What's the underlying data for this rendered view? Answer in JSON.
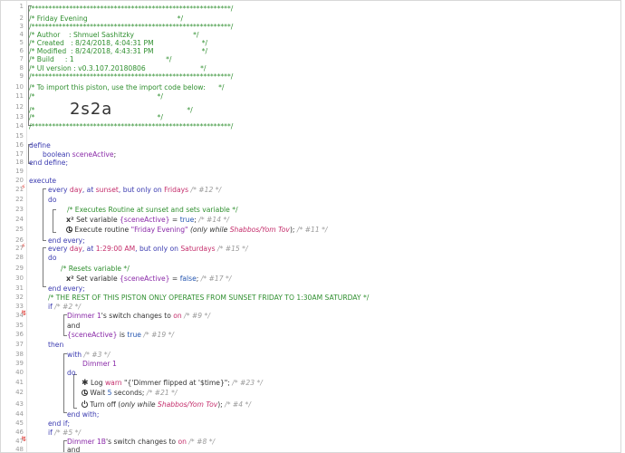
{
  "lines": {
    "l1": "/**********************************************************/",
    "l2": "/* Friday Evening                                         */",
    "l3": "/**********************************************************/",
    "l4": "/* Author    : Shmuel Sashitzky                           */",
    "l5": "/* Created   : 8/24/2018, 4:04:31 PM                      */",
    "l6": "/* Modified  : 8/24/2018, 4:43:31 PM                      */",
    "l7": "/* Build     : 1                                          */",
    "l8": "/* UI version : v0.3.107.20180806                         */",
    "l9": "/**********************************************************/",
    "l10": "/* To import this piston, use the import code below:      */",
    "l11": "/*                                                        */",
    "l12a": "/*                ",
    "l12b": "2s2a",
    "l12c": "                                  */",
    "l13": "/*                                                        */",
    "l14": "/**********************************************************/"
  },
  "define": {
    "open": "define",
    "type": "boolean",
    "name": "sceneActive",
    "semi": ";",
    "close": "end define;"
  },
  "execute": {
    "open": "execute",
    "t1": {
      "a": "every ",
      "day": "day",
      "b": ", at ",
      "sunset": "sunset",
      "c": ", but only on ",
      "fridays": "Fridays",
      "num": " /* #12 */"
    },
    "do1": "do",
    "c24": "/* Executes Routine at sunset and sets variable */",
    "set1": {
      "icon": "x²",
      "a": "Set variable ",
      "var": "{sceneActive}",
      "b": " = ",
      "val": "true",
      "c": ";",
      "num": " /* #14 */"
    },
    "exec1": {
      "a": "Execute routine ",
      "str": "\"Friday Evening\"",
      "b": " (only while ",
      "cond": "Shabbos/Yom Tov",
      "c": ");",
      "num": " /* #11 */"
    },
    "end1": "end every;",
    "t2": {
      "a": "every ",
      "day": "day",
      "b": ", at ",
      "time": "1:29:00 AM",
      "c": ", but only on ",
      "saturdays": "Saturdays",
      "num": " /* #15 */"
    },
    "do2": "do",
    "c29": "/* Resets variable */",
    "set2": {
      "icon": "x²",
      "a": "Set variable ",
      "var": "{sceneActive}",
      "b": " = ",
      "val": "false",
      "c": ";",
      "num": " /* #17 */"
    },
    "end2": "end every;",
    "c32": "/* THE REST OF THIS PISTON ONLY OPERATES FROM SUNSET FRIDAY TO 1:30AM SATURDAY */",
    "if1": "if",
    "if1num": " /* #2 */",
    "cond1": {
      "dev": "Dimmer 1",
      "a": "'s switch changes to ",
      "val": "on",
      "num": " /* #9 */"
    },
    "and1": "and",
    "cond2": {
      "var": "{sceneActive}",
      "a": " is ",
      "val": "true",
      "num": " /* #19 */"
    },
    "then1": "then",
    "with1": "with",
    "with1num": " /* #3 */",
    "withdev": "Dimmer 1",
    "do3": "do",
    "log": {
      "a": "Log ",
      "lvl": "warn",
      "b": " \"{'Dimmer flipped at '$time}\";",
      "num": " /* #23 */"
    },
    "wait": {
      "a": "Wait ",
      "val": "5",
      "b": " seconds;",
      "num": " /* #21 */"
    },
    "turnoff": {
      "a": "Turn off (",
      "b": "only while ",
      "cond": "Shabbos/Yom Tov",
      "c": ");",
      "num": " /* #4 */"
    },
    "endwith": "end with;",
    "endif": "end if;",
    "if2": "if",
    "if2num": " /* #5 */",
    "cond3": {
      "dev": "Dimmer 1B",
      "a": "'s switch changes to ",
      "val": "on",
      "num": " /* #8 */"
    },
    "and2": "and"
  },
  "gutter_markers": {
    "m21": "⚡",
    "m27": "⚡",
    "m34": "↯",
    "m47": "↯"
  }
}
